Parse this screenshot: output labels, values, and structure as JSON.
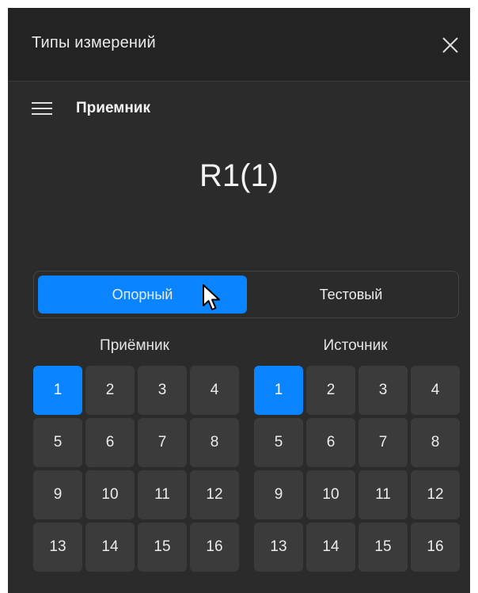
{
  "window": {
    "title": "Типы измерений"
  },
  "section": {
    "title": "Приемник"
  },
  "measurement": {
    "value": "R1(1)"
  },
  "toggle": {
    "left_label": "Опорный",
    "right_label": "Тестовый",
    "selected": "left"
  },
  "receiver": {
    "label": "Приёмник",
    "selected": "1",
    "cells": [
      "1",
      "2",
      "3",
      "4",
      "5",
      "6",
      "7",
      "8",
      "9",
      "10",
      "11",
      "12",
      "13",
      "14",
      "15",
      "16"
    ]
  },
  "source": {
    "label": "Источник",
    "selected": "1",
    "cells": [
      "1",
      "2",
      "3",
      "4",
      "5",
      "6",
      "7",
      "8",
      "9",
      "10",
      "11",
      "12",
      "13",
      "14",
      "15",
      "16"
    ]
  },
  "colors": {
    "accent": "#0a84ff",
    "background": "#2b2b2b",
    "cell": "#3b3b3b"
  },
  "icons": {
    "menu": "hamburger-menu-icon",
    "close": "close-icon",
    "cursor": "mouse-pointer-icon"
  }
}
